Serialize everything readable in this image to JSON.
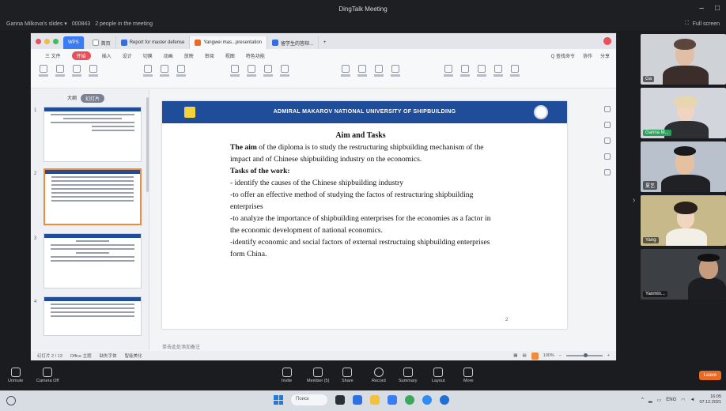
{
  "window": {
    "title": "DingTalk Meeting",
    "minimize": "–",
    "restore": "□"
  },
  "meeting_bar": {
    "host": "Ganna Milkova's slides ▾",
    "dropdown": "▾",
    "room_id": "000843",
    "people": "2 people in the meeting",
    "fullscreen": "Full screen"
  },
  "wps": {
    "app_tab": "WPS",
    "tabs": [
      {
        "label": "首页",
        "color": "#ffffff"
      },
      {
        "label": "Report for master defense",
        "color": "#2f6fe4"
      },
      {
        "label": "Yangwei mas...presentation",
        "color": "#e86c24"
      },
      {
        "label": "留学生的答辩...",
        "color": "#2f6fe4"
      }
    ],
    "add_tab": "+",
    "menu": [
      "三 文件",
      "开始",
      "插入",
      "设计",
      "切换",
      "动画",
      "放映",
      "审阅",
      "视图",
      "特色功能"
    ],
    "menu_highlight": "开始",
    "menu_right": [
      "Q 查找命令",
      "协作",
      "分享"
    ],
    "thumb_tabs": {
      "outline": "大纲",
      "slides": "幻灯片"
    },
    "thumbnail_numbers": [
      "1",
      "2",
      "3",
      "4"
    ],
    "add_slide": "+",
    "notes_placeholder": "单击此处添加备注",
    "status": {
      "slide": "幻灯片 2 / 13",
      "theme": "Office 主题",
      "font_missing": "缺失字体",
      "beautify": "智能美化",
      "zoom": "100%"
    }
  },
  "slide": {
    "university": "ADMIRAL MAKAROV NATIONAL UNIVERSITY OF SHIPBUILDING",
    "title": "Aim and Tasks",
    "aim_label": "The aim",
    "aim_text": " of the diploma is to study the restructuring shipbuilding mechanism of the impact and of Chinese shipbuilding industry on the economics.",
    "tasks_label": "Tasks of the work:",
    "tasks": [
      "- identify the causes of the Chinese shipbuilding industry",
      "-to offer an effective method of studying the factos of restructuring shipbuilding enterprises",
      "-to analyze the importance of shipbuilding enterprises for the economies as a factor in the economic development of national economics.",
      "-identify economic and social factors of external restructuing shipbuilding enterprises form China."
    ],
    "page_number": "2"
  },
  "participants": [
    {
      "name": "Ga",
      "bg": "#cfd3d8",
      "skin": "#e0bfa6",
      "cloth": "#3a2d2a",
      "hair": "#5a463a"
    },
    {
      "name": "Ganna M...",
      "bg": "#d2d6dc",
      "skin": "#f0d3c2",
      "cloth": "#2d2f33",
      "hair": "#e8d6b0"
    },
    {
      "name": "夏艺",
      "bg": "#b9c2cc",
      "skin": "#e6c1a1",
      "cloth": "#1f2124",
      "hair": "#1a1a1a"
    },
    {
      "name": "Yang",
      "bg": "#c8b98a",
      "skin": "#f1d5bf",
      "cloth": "#f2efe7",
      "hair": "#2a201b"
    },
    {
      "name": "Yanmin...",
      "bg": "#3c3f44",
      "skin": "#c59d7e",
      "cloth": "#1d1e21",
      "hair": "#111111"
    }
  ],
  "toolbar": {
    "left": [
      {
        "label": "Unmute",
        "icon": "microphone-muted-icon"
      },
      {
        "label": "Camera Off",
        "icon": "camera-off-icon"
      }
    ],
    "center": [
      {
        "label": "Invite",
        "icon": "invite-icon"
      },
      {
        "label": "Member (5)",
        "icon": "members-icon"
      },
      {
        "label": "Share",
        "icon": "share-screen-icon"
      },
      {
        "label": "Record",
        "icon": "record-icon"
      },
      {
        "label": "Summary",
        "icon": "summary-icon"
      },
      {
        "label": "Layout",
        "icon": "layout-icon"
      },
      {
        "label": "More",
        "icon": "more-icon"
      }
    ],
    "leave": "Leave"
  },
  "taskbar": {
    "search": "Поиск",
    "lang": "ENG",
    "time": "16:05",
    "date": "07.12.2021"
  }
}
